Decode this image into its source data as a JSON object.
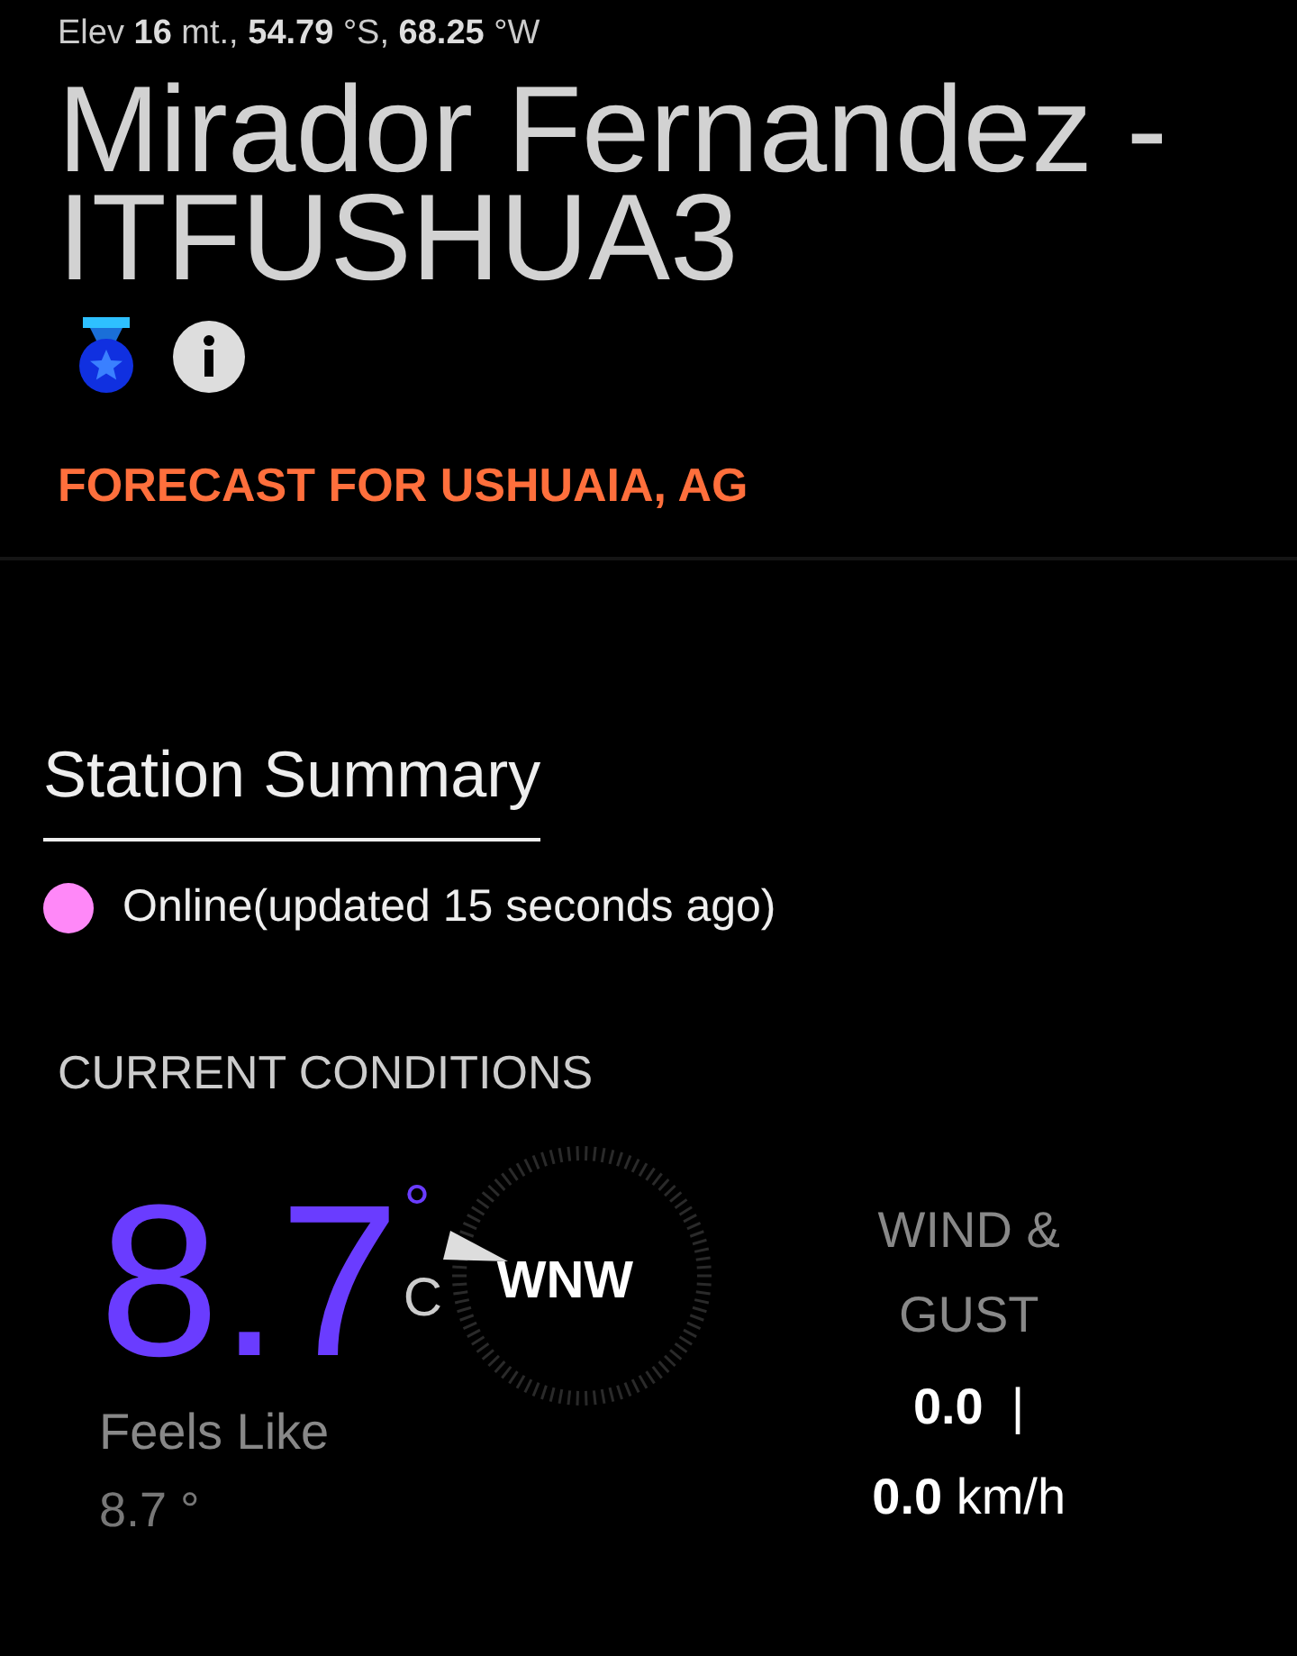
{
  "station": {
    "location": "Elev **16** mt., **54.79** °S, **68.25** °W",
    "title": "Mirador Fernandez - ITFUSHUA3",
    "forecast_link": "FORECAST FOR USHUAIA, AG"
  },
  "summary": {
    "title": "Station Summary",
    "status": {
      "text": "Online(updated 15 seconds ago)",
      "color": "#ff88f8"
    }
  },
  "conditions": {
    "title": "CURRENT CONDITIONS",
    "temperature": "8.7",
    "degree": "°",
    "unit": "C",
    "feels_like_label": "Feels Like",
    "feels_like": "8.7 °",
    "wind_direction": "WNW",
    "wind_label": "WIND & GUST",
    "wind_speed": "**0.0**  |",
    "gust_speed": "**0.0** km/h"
  }
}
